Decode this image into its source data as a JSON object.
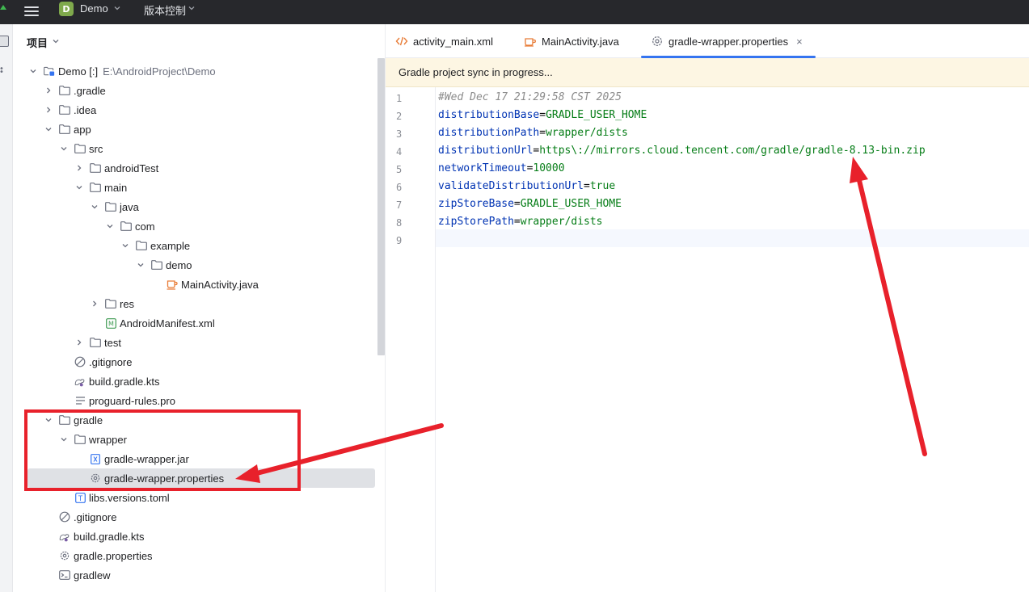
{
  "topbar": {
    "project_badge": "D",
    "project_name": "Demo",
    "vcs_label": "版本控制"
  },
  "project_panel": {
    "title": "项目",
    "root_path": "E:\\AndroidProject\\Demo",
    "tree": [
      {
        "label": "Demo [:]",
        "depth": 0,
        "expanded": true,
        "icon": "module-folder-icon"
      },
      {
        "label": ".gradle",
        "depth": 1,
        "expanded": false,
        "icon": "folder-icon"
      },
      {
        "label": ".idea",
        "depth": 1,
        "expanded": false,
        "icon": "folder-icon"
      },
      {
        "label": "app",
        "depth": 1,
        "expanded": true,
        "icon": "folder-icon"
      },
      {
        "label": "src",
        "depth": 2,
        "expanded": true,
        "icon": "folder-icon"
      },
      {
        "label": "androidTest",
        "depth": 3,
        "expanded": false,
        "icon": "folder-icon"
      },
      {
        "label": "main",
        "depth": 3,
        "expanded": true,
        "icon": "folder-icon"
      },
      {
        "label": "java",
        "depth": 4,
        "expanded": true,
        "icon": "folder-icon"
      },
      {
        "label": "com",
        "depth": 5,
        "expanded": true,
        "icon": "folder-icon"
      },
      {
        "label": "example",
        "depth": 6,
        "expanded": true,
        "icon": "folder-icon"
      },
      {
        "label": "demo",
        "depth": 7,
        "expanded": true,
        "icon": "folder-icon"
      },
      {
        "label": "MainActivity.java",
        "depth": 8,
        "expanded": null,
        "icon": "java-class-icon"
      },
      {
        "label": "res",
        "depth": 4,
        "expanded": false,
        "icon": "folder-icon"
      },
      {
        "label": "AndroidManifest.xml",
        "depth": 4,
        "expanded": null,
        "icon": "manifest-icon"
      },
      {
        "label": "test",
        "depth": 3,
        "expanded": false,
        "icon": "folder-icon"
      },
      {
        "label": ".gitignore",
        "depth": 2,
        "expanded": null,
        "icon": "gitignore-icon"
      },
      {
        "label": "build.gradle.kts",
        "depth": 2,
        "expanded": null,
        "icon": "gradle-icon"
      },
      {
        "label": "proguard-rules.pro",
        "depth": 2,
        "expanded": null,
        "icon": "text-file-icon"
      },
      {
        "label": "gradle",
        "depth": 1,
        "expanded": true,
        "icon": "folder-icon"
      },
      {
        "label": "wrapper",
        "depth": 2,
        "expanded": true,
        "icon": "folder-icon"
      },
      {
        "label": "gradle-wrapper.jar",
        "depth": 3,
        "expanded": null,
        "icon": "jar-icon"
      },
      {
        "label": "gradle-wrapper.properties",
        "depth": 3,
        "expanded": null,
        "icon": "properties-icon",
        "selected": true
      },
      {
        "label": "libs.versions.toml",
        "depth": 2,
        "expanded": null,
        "icon": "toml-icon"
      },
      {
        "label": ".gitignore",
        "depth": 1,
        "expanded": null,
        "icon": "gitignore-icon"
      },
      {
        "label": "build.gradle.kts",
        "depth": 1,
        "expanded": null,
        "icon": "gradle-icon"
      },
      {
        "label": "gradle.properties",
        "depth": 1,
        "expanded": null,
        "icon": "properties-icon"
      },
      {
        "label": "gradlew",
        "depth": 1,
        "expanded": null,
        "icon": "shell-script-icon"
      }
    ]
  },
  "editor": {
    "tabs": [
      {
        "label": "activity_main.xml",
        "icon": "xml-icon",
        "active": false
      },
      {
        "label": "MainActivity.java",
        "icon": "java-class-icon",
        "active": false
      },
      {
        "label": "gradle-wrapper.properties",
        "icon": "properties-icon",
        "active": true
      }
    ],
    "close_glyph": "×",
    "banner": "Gradle project sync in progress...",
    "current_line": 9,
    "lines": [
      {
        "n": "1",
        "comment": "#Wed Dec 17 21:29:58 CST 2025"
      },
      {
        "n": "2",
        "key": "distributionBase",
        "value": "GRADLE_USER_HOME"
      },
      {
        "n": "3",
        "key": "distributionPath",
        "value": "wrapper/dists"
      },
      {
        "n": "4",
        "key": "distributionUrl",
        "value": "https\\://mirrors.cloud.tencent.com/gradle/gradle-8.13-bin.zip"
      },
      {
        "n": "5",
        "key": "networkTimeout",
        "value": "10000"
      },
      {
        "n": "6",
        "key": "validateDistributionUrl",
        "value": "true"
      },
      {
        "n": "7",
        "key": "zipStoreBase",
        "value": "GRADLE_USER_HOME"
      },
      {
        "n": "8",
        "key": "zipStorePath",
        "value": "wrapper/dists"
      },
      {
        "n": "9"
      }
    ]
  },
  "colors": {
    "annotation_red": "#e8212b",
    "accent_blue": "#3574f0",
    "banner_bg": "#fdf6e3",
    "folder_stroke": "#6c707e",
    "java_orange": "#e87c37",
    "manifest_green": "#3f9b53",
    "gradle_purple": "#7b5ea7"
  }
}
